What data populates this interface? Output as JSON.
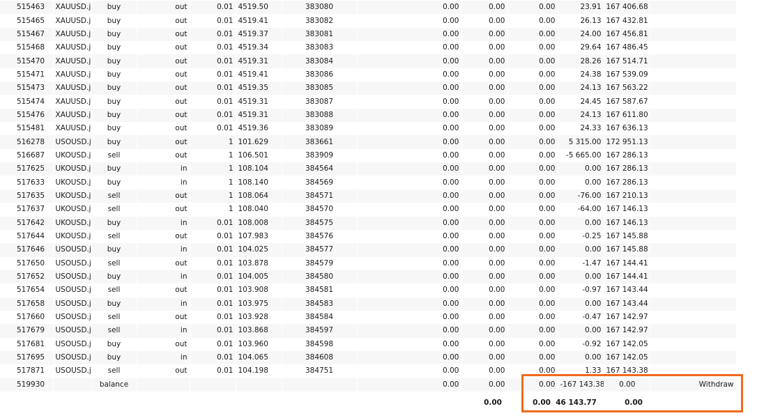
{
  "highlight_color": "#f26a1b",
  "rows": [
    [
      "515463",
      "XAUUSD.j",
      "buy",
      "out",
      "0.01",
      "4519.50",
      "383080",
      "0.00",
      "0.00",
      "0.00",
      "23.91",
      "167 406.68",
      ""
    ],
    [
      "515465",
      "XAUUSD.j",
      "buy",
      "out",
      "0.01",
      "4519.41",
      "383082",
      "0.00",
      "0.00",
      "0.00",
      "26.13",
      "167 432.81",
      ""
    ],
    [
      "515467",
      "XAUUSD.j",
      "buy",
      "out",
      "0.01",
      "4519.37",
      "383081",
      "0.00",
      "0.00",
      "0.00",
      "24.00",
      "167 456.81",
      ""
    ],
    [
      "515468",
      "XAUUSD.j",
      "buy",
      "out",
      "0.01",
      "4519.34",
      "383083",
      "0.00",
      "0.00",
      "0.00",
      "29.64",
      "167 486.45",
      ""
    ],
    [
      "515470",
      "XAUUSD.j",
      "buy",
      "out",
      "0.01",
      "4519.31",
      "383084",
      "0.00",
      "0.00",
      "0.00",
      "28.26",
      "167 514.71",
      ""
    ],
    [
      "515471",
      "XAUUSD.j",
      "buy",
      "out",
      "0.01",
      "4519.41",
      "383086",
      "0.00",
      "0.00",
      "0.00",
      "24.38",
      "167 539.09",
      ""
    ],
    [
      "515473",
      "XAUUSD.j",
      "buy",
      "out",
      "0.01",
      "4519.35",
      "383085",
      "0.00",
      "0.00",
      "0.00",
      "24.13",
      "167 563.22",
      ""
    ],
    [
      "515474",
      "XAUUSD.j",
      "buy",
      "out",
      "0.01",
      "4519.31",
      "383087",
      "0.00",
      "0.00",
      "0.00",
      "24.45",
      "167 587.67",
      ""
    ],
    [
      "515476",
      "XAUUSD.j",
      "buy",
      "out",
      "0.01",
      "4519.31",
      "383088",
      "0.00",
      "0.00",
      "0.00",
      "24.13",
      "167 611.80",
      ""
    ],
    [
      "515481",
      "XAUUSD.j",
      "buy",
      "out",
      "0.01",
      "4519.36",
      "383089",
      "0.00",
      "0.00",
      "0.00",
      "24.33",
      "167 636.13",
      ""
    ],
    [
      "516278",
      "USOUSD.j",
      "buy",
      "out",
      "1",
      "101.629",
      "383661",
      "0.00",
      "0.00",
      "0.00",
      "5 315.00",
      "172 951.13",
      ""
    ],
    [
      "516687",
      "UKOUSD.j",
      "sell",
      "out",
      "1",
      "106.501",
      "383909",
      "0.00",
      "0.00",
      "0.00",
      "-5 665.00",
      "167 286.13",
      ""
    ],
    [
      "517625",
      "UKOUSD.j",
      "buy",
      "in",
      "1",
      "108.104",
      "384564",
      "0.00",
      "0.00",
      "0.00",
      "0.00",
      "167 286.13",
      ""
    ],
    [
      "517633",
      "UKOUSD.j",
      "buy",
      "in",
      "1",
      "108.140",
      "384569",
      "0.00",
      "0.00",
      "0.00",
      "0.00",
      "167 286.13",
      ""
    ],
    [
      "517635",
      "UKOUSD.j",
      "sell",
      "out",
      "1",
      "108.064",
      "384571",
      "0.00",
      "0.00",
      "0.00",
      "-76.00",
      "167 210.13",
      ""
    ],
    [
      "517637",
      "UKOUSD.j",
      "sell",
      "out",
      "1",
      "108.040",
      "384570",
      "0.00",
      "0.00",
      "0.00",
      "-64.00",
      "167 146.13",
      ""
    ],
    [
      "517642",
      "UKOUSD.j",
      "buy",
      "in",
      "0.01",
      "108.008",
      "384575",
      "0.00",
      "0.00",
      "0.00",
      "0.00",
      "167 146.13",
      ""
    ],
    [
      "517644",
      "UKOUSD.j",
      "sell",
      "out",
      "0.01",
      "107.983",
      "384576",
      "0.00",
      "0.00",
      "0.00",
      "-0.25",
      "167 145.88",
      ""
    ],
    [
      "517646",
      "USOUSD.j",
      "buy",
      "in",
      "0.01",
      "104.025",
      "384577",
      "0.00",
      "0.00",
      "0.00",
      "0.00",
      "167 145.88",
      ""
    ],
    [
      "517650",
      "USOUSD.j",
      "sell",
      "out",
      "0.01",
      "103.878",
      "384579",
      "0.00",
      "0.00",
      "0.00",
      "-1.47",
      "167 144.41",
      ""
    ],
    [
      "517652",
      "USOUSD.j",
      "buy",
      "in",
      "0.01",
      "104.005",
      "384580",
      "0.00",
      "0.00",
      "0.00",
      "0.00",
      "167 144.41",
      ""
    ],
    [
      "517654",
      "USOUSD.j",
      "sell",
      "out",
      "0.01",
      "103.908",
      "384581",
      "0.00",
      "0.00",
      "0.00",
      "-0.97",
      "167 143.44",
      ""
    ],
    [
      "517658",
      "USOUSD.j",
      "buy",
      "in",
      "0.01",
      "103.975",
      "384583",
      "0.00",
      "0.00",
      "0.00",
      "0.00",
      "167 143.44",
      ""
    ],
    [
      "517660",
      "USOUSD.j",
      "sell",
      "out",
      "0.01",
      "103.928",
      "384584",
      "0.00",
      "0.00",
      "0.00",
      "-0.47",
      "167 142.97",
      ""
    ],
    [
      "517679",
      "USOUSD.j",
      "sell",
      "in",
      "0.01",
      "103.868",
      "384597",
      "0.00",
      "0.00",
      "0.00",
      "0.00",
      "167 142.97",
      ""
    ],
    [
      "517681",
      "USOUSD.j",
      "buy",
      "out",
      "0.01",
      "103.960",
      "384598",
      "0.00",
      "0.00",
      "0.00",
      "-0.92",
      "167 142.05",
      ""
    ],
    [
      "517695",
      "USOUSD.j",
      "buy",
      "in",
      "0.01",
      "104.065",
      "384608",
      "0.00",
      "0.00",
      "0.00",
      "0.00",
      "167 142.05",
      ""
    ],
    [
      "517871",
      "USOUSD.j",
      "sell",
      "out",
      "0.01",
      "104.198",
      "384751",
      "0.00",
      "0.00",
      "0.00",
      "1.33",
      "167 143.38",
      ""
    ]
  ],
  "balance_row": {
    "deal": "519930",
    "type": "balance",
    "commission": "0.00",
    "fee": "0.00",
    "swap": "0.00",
    "profit": "-167 143.38",
    "balance": "0.00",
    "comment": "Withdraw"
  },
  "totals": {
    "commission": "0.00",
    "swap": "0.00",
    "profit": "46 143.77",
    "balance": "0.00"
  }
}
